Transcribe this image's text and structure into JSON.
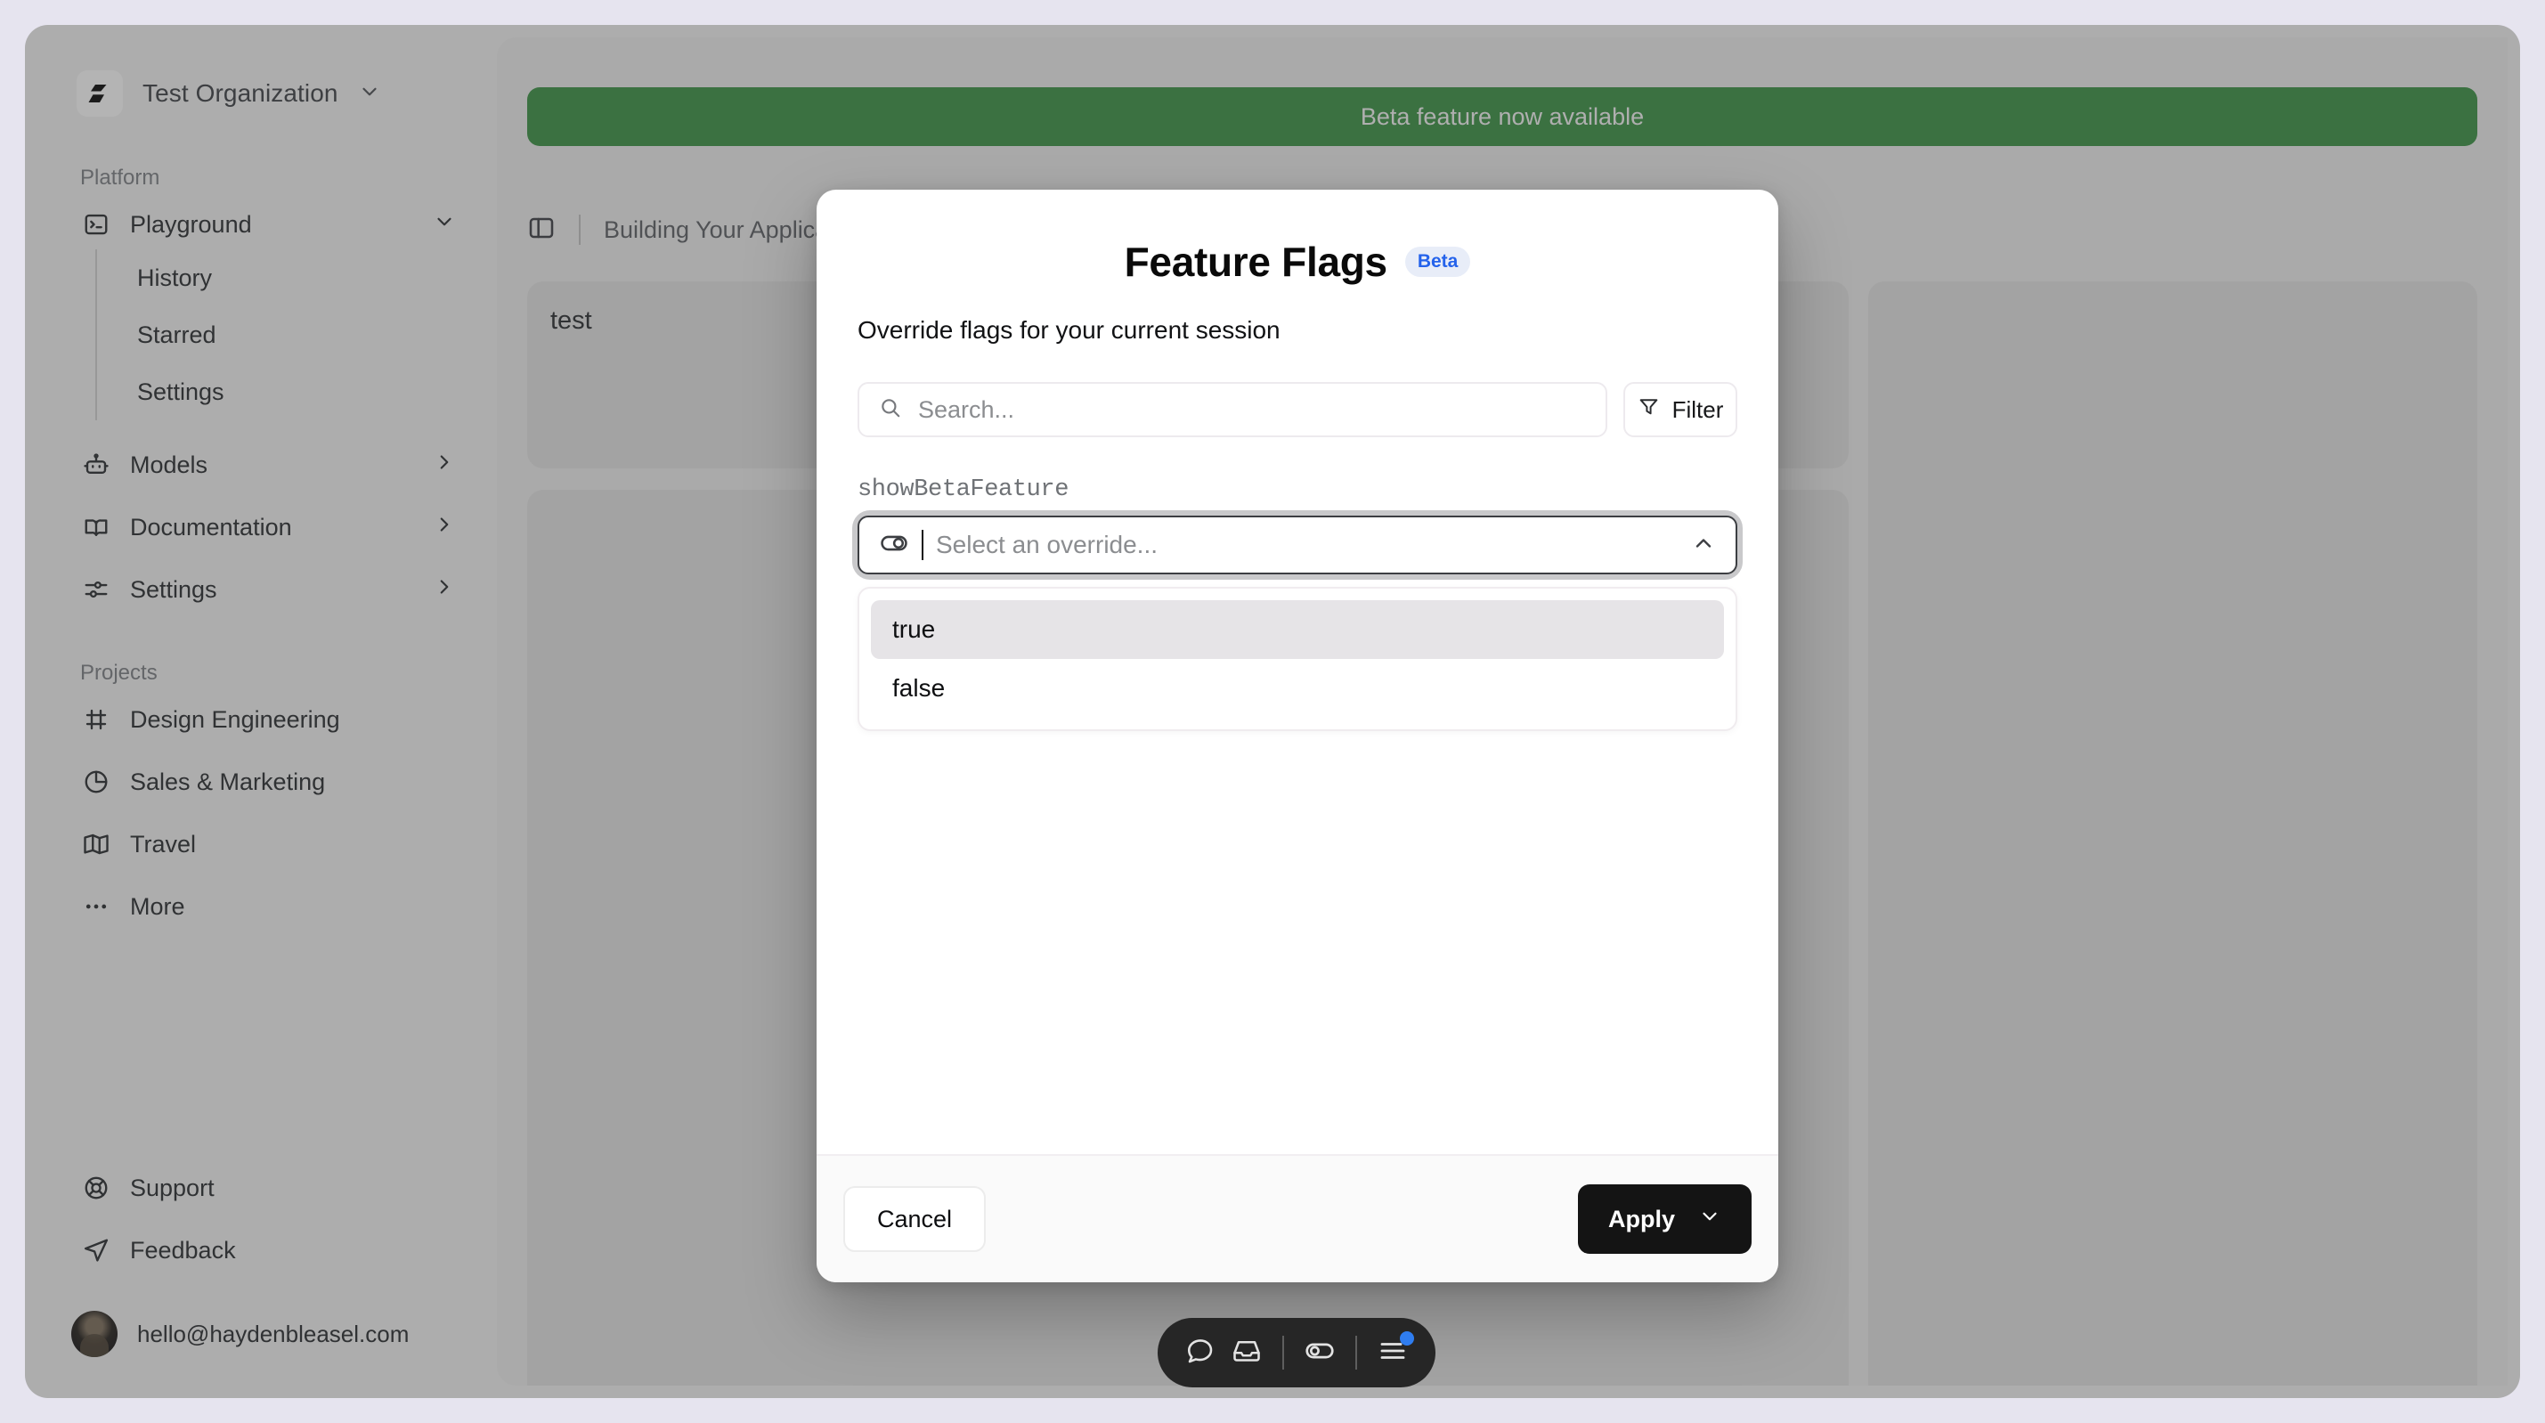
{
  "window": {
    "sidebar": {
      "organization": {
        "name": "Test Organization",
        "logo_icon": "org-logo-icon",
        "chevron_icon": "chevron-down-icon"
      },
      "sections": [
        {
          "label": "Platform",
          "items": [
            {
              "label": "Playground",
              "icon": "terminal-icon",
              "trailing_icon": "chevron-down-icon",
              "expanded": true,
              "children": [
                {
                  "label": "History"
                },
                {
                  "label": "Starred"
                },
                {
                  "label": "Settings"
                }
              ]
            },
            {
              "label": "Models",
              "icon": "bot-icon",
              "trailing_icon": "chevron-right-icon"
            },
            {
              "label": "Documentation",
              "icon": "book-open-icon",
              "trailing_icon": "chevron-right-icon"
            },
            {
              "label": "Settings",
              "icon": "settings-sliders-icon",
              "trailing_icon": "chevron-right-icon"
            }
          ]
        },
        {
          "label": "Projects",
          "items": [
            {
              "label": "Design Engineering",
              "icon": "frame-icon"
            },
            {
              "label": "Sales & Marketing",
              "icon": "pie-chart-icon"
            },
            {
              "label": "Travel",
              "icon": "map-icon"
            },
            {
              "label": "More",
              "icon": "ellipsis-icon"
            }
          ]
        }
      ],
      "footer": [
        {
          "label": "Support",
          "icon": "lifebuoy-icon"
        },
        {
          "label": "Feedback",
          "icon": "send-icon"
        }
      ],
      "account": {
        "email": "hello@haydenbleasel.com",
        "avatar": "user-avatar"
      }
    },
    "main": {
      "banner": {
        "text": "Beta feature now available",
        "color": "#3b7d43",
        "text_color": "#c9c9c9"
      },
      "breadcrumb": {
        "sidebar_toggle_icon": "panel-left-icon",
        "text": "Building Your Application"
      },
      "content_label": "test"
    },
    "dock": {
      "buttons": [
        {
          "icon": "message-circle-icon",
          "badge": null
        },
        {
          "icon": "inbox-icon",
          "badge": null
        },
        {
          "icon": "feature-flag-toggle-icon",
          "badge": null
        },
        {
          "icon": "menu-list-icon",
          "badge": "blue-dot"
        }
      ],
      "badge_color": "#2f7df0"
    }
  },
  "modal": {
    "title": "Feature Flags",
    "badge": "Beta",
    "badge_color": "#2563eb",
    "badge_bg": "#e8edf8",
    "subtitle": "Override flags for your current session",
    "search": {
      "placeholder": "Search...",
      "value": "",
      "icon": "search-icon"
    },
    "filter": {
      "label": "Filter",
      "icon": "filter-icon"
    },
    "flag": {
      "name": "showBetaFeature",
      "select": {
        "placeholder": "Select an override...",
        "value": "",
        "leading_icon": "toggle-right-icon",
        "chevron_icon": "chevron-up-icon",
        "open": true,
        "options": [
          {
            "label": "true",
            "highlighted": true
          },
          {
            "label": "false",
            "highlighted": false
          }
        ]
      }
    },
    "footer": {
      "cancel_label": "Cancel",
      "apply_label": "Apply",
      "apply_chevron_icon": "chevron-down-icon"
    }
  }
}
